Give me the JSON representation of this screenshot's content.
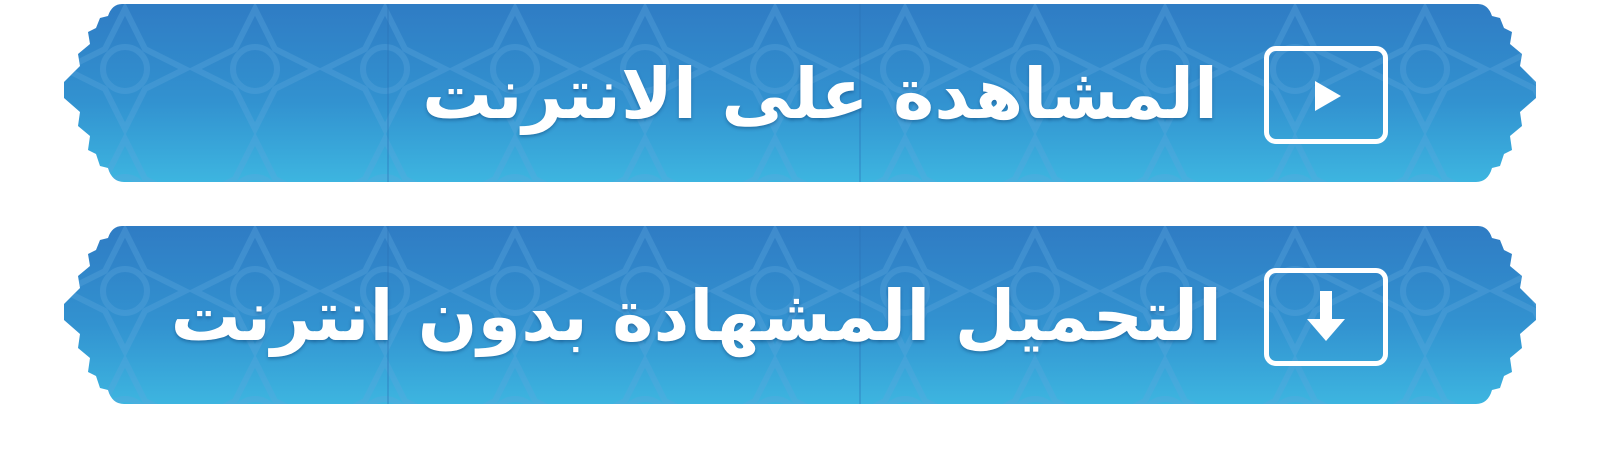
{
  "buttons": {
    "watch_online": {
      "label": "المشاهدة على الانترنت",
      "icon": "play-icon"
    },
    "download_offline": {
      "label": "التحميل المشهادة بدون انترنت",
      "icon": "download-arrow-icon"
    }
  },
  "colors": {
    "banner_top": "#2f7fc6",
    "banner_bottom": "#3bb0de",
    "pattern": "#5fa8dc",
    "text": "#ffffff"
  }
}
